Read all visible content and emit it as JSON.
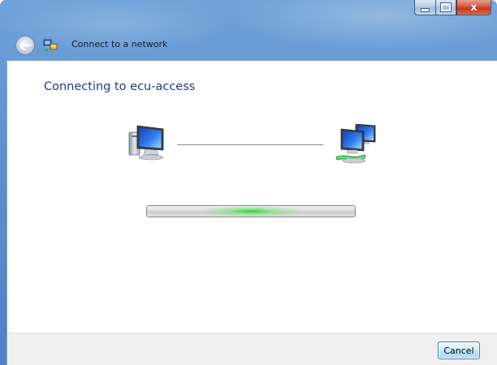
{
  "window": {
    "title": "Connect to a network",
    "caption_buttons": {
      "minimize_icon": "minimize-icon",
      "maximize_icon": "maximize-icon",
      "close_glyph": "x"
    }
  },
  "nav": {
    "back_icon": "back-arrow-icon",
    "app_icon": "network-connect-icon"
  },
  "main": {
    "heading": "Connecting to ecu-access",
    "left_device_icon": "computer-icon",
    "right_device_icon": "network-computers-icon"
  },
  "progress": {
    "style": "marquee",
    "glow_position": 0.5
  },
  "footer": {
    "cancel_label": "Cancel"
  },
  "colors": {
    "heading": "#1e3b8a",
    "titlebar": "#5b8fcf",
    "progress_glow": "#28d23c"
  }
}
